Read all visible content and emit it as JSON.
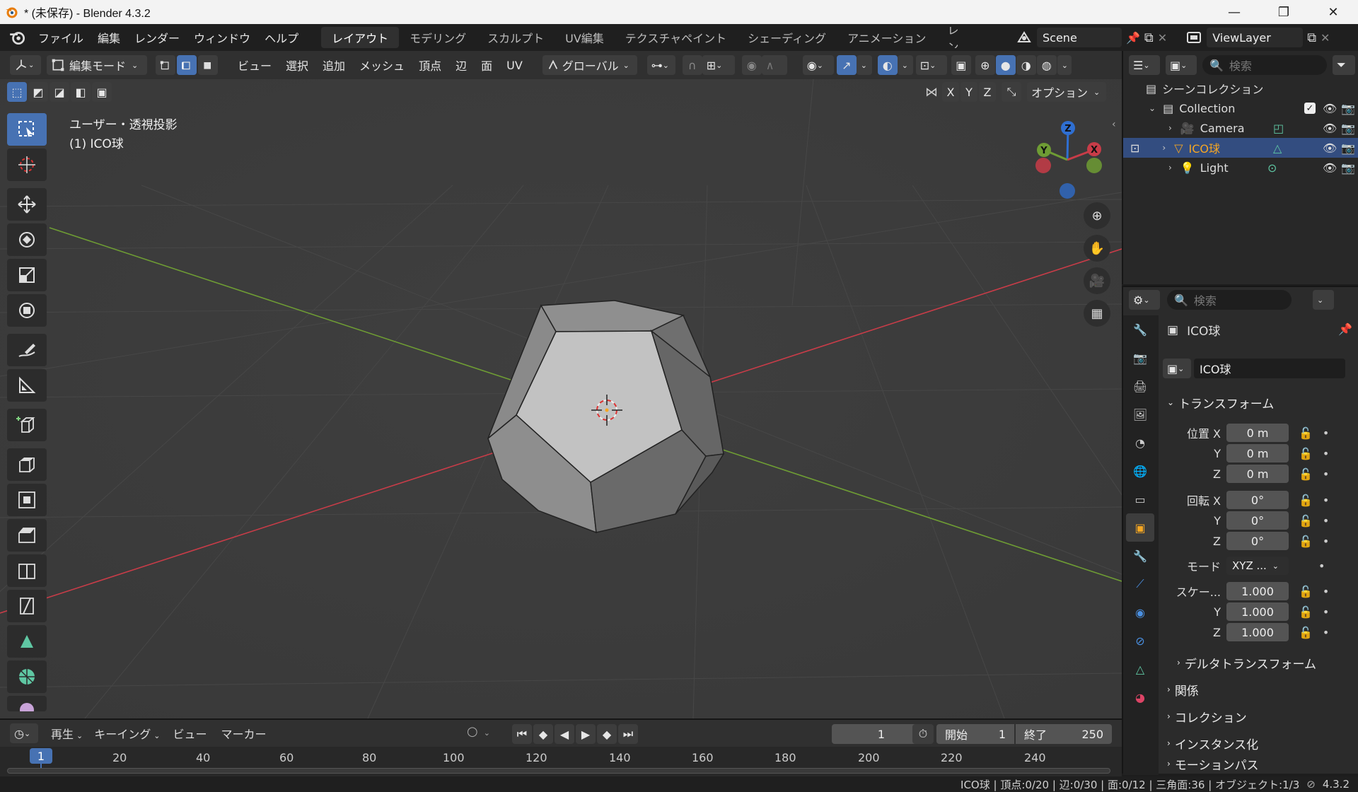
{
  "window": {
    "title": "* (未保存) - Blender 4.3.2",
    "minimize": "—",
    "maximize": "❐",
    "close": "✕"
  },
  "menu": [
    "ファイル",
    "編集",
    "レンダー",
    "ウィンドウ",
    "ヘルプ"
  ],
  "workspaces": [
    "レイアウト",
    "モデリング",
    "スカルプト",
    "UV編集",
    "テクスチャペイント",
    "シェーディング",
    "アニメーション",
    "レン"
  ],
  "active_workspace": "レイアウト",
  "scene": {
    "name": "Scene",
    "view_layer": "ViewLayer"
  },
  "viewport_header": {
    "mode": "編集モード",
    "menus": [
      "ビュー",
      "選択",
      "追加",
      "メッシュ",
      "頂点",
      "辺",
      "面",
      "UV"
    ],
    "transform_orientation": "グローバル",
    "axis_x": "X",
    "axis_y": "Y",
    "axis_z": "Z",
    "options": "オプション"
  },
  "viewport": {
    "view_name": "ユーザー・透視投影",
    "object_label": "(1) ICO球",
    "gizmo": {
      "x": "X",
      "y": "Y",
      "z": "Z"
    }
  },
  "outliner": {
    "search_placeholder": "検索",
    "scene_collection": "シーンコレクション",
    "collection": "Collection",
    "items": [
      {
        "name": "Camera",
        "selected": false
      },
      {
        "name": "ICO球",
        "selected": true
      },
      {
        "name": "Light",
        "selected": false
      }
    ]
  },
  "properties": {
    "search_placeholder": "検索",
    "object_name": "ICO球",
    "object_field": "ICO球",
    "transform_label": "トランスフォーム",
    "location_label": "位置 X",
    "location": [
      "0 m",
      "0 m",
      "0 m"
    ],
    "rotation_label": "回転 X",
    "rotation": [
      "0°",
      "0°",
      "0°"
    ],
    "mode_label": "モード",
    "mode_value": "XYZ ...",
    "scale_label": "スケー...",
    "scale": [
      "1.000",
      "1.000",
      "1.000"
    ],
    "y_label": "Y",
    "z_label": "Z",
    "delta": "デルタトランスフォーム",
    "relations": "関係",
    "collection": "コレクション",
    "instancing": "インスタンス化",
    "motion_paths": "モーションパス"
  },
  "timeline": {
    "playback": "再生",
    "keying": "キーイング",
    "view": "ビュー",
    "marker": "マーカー",
    "current_frame": "1",
    "start_label": "開始",
    "start": "1",
    "end_label": "終了",
    "end": "250",
    "ticks": [
      "1",
      "20",
      "40",
      "60",
      "80",
      "100",
      "120",
      "140",
      "160",
      "180",
      "200",
      "220",
      "240"
    ]
  },
  "status": "ICO球 | 頂点:0/20 | 辺:0/30 | 面:0/12 | 三角面:36 | オブジェクト:1/3",
  "version": "4.3.2",
  "colors": {
    "accent": "#4772b3",
    "selected_row": "#334d80",
    "active_object": "#f5a623",
    "x_axis": "#c83c48",
    "y_axis": "#6e9c34",
    "z_axis": "#2f6fd1"
  }
}
